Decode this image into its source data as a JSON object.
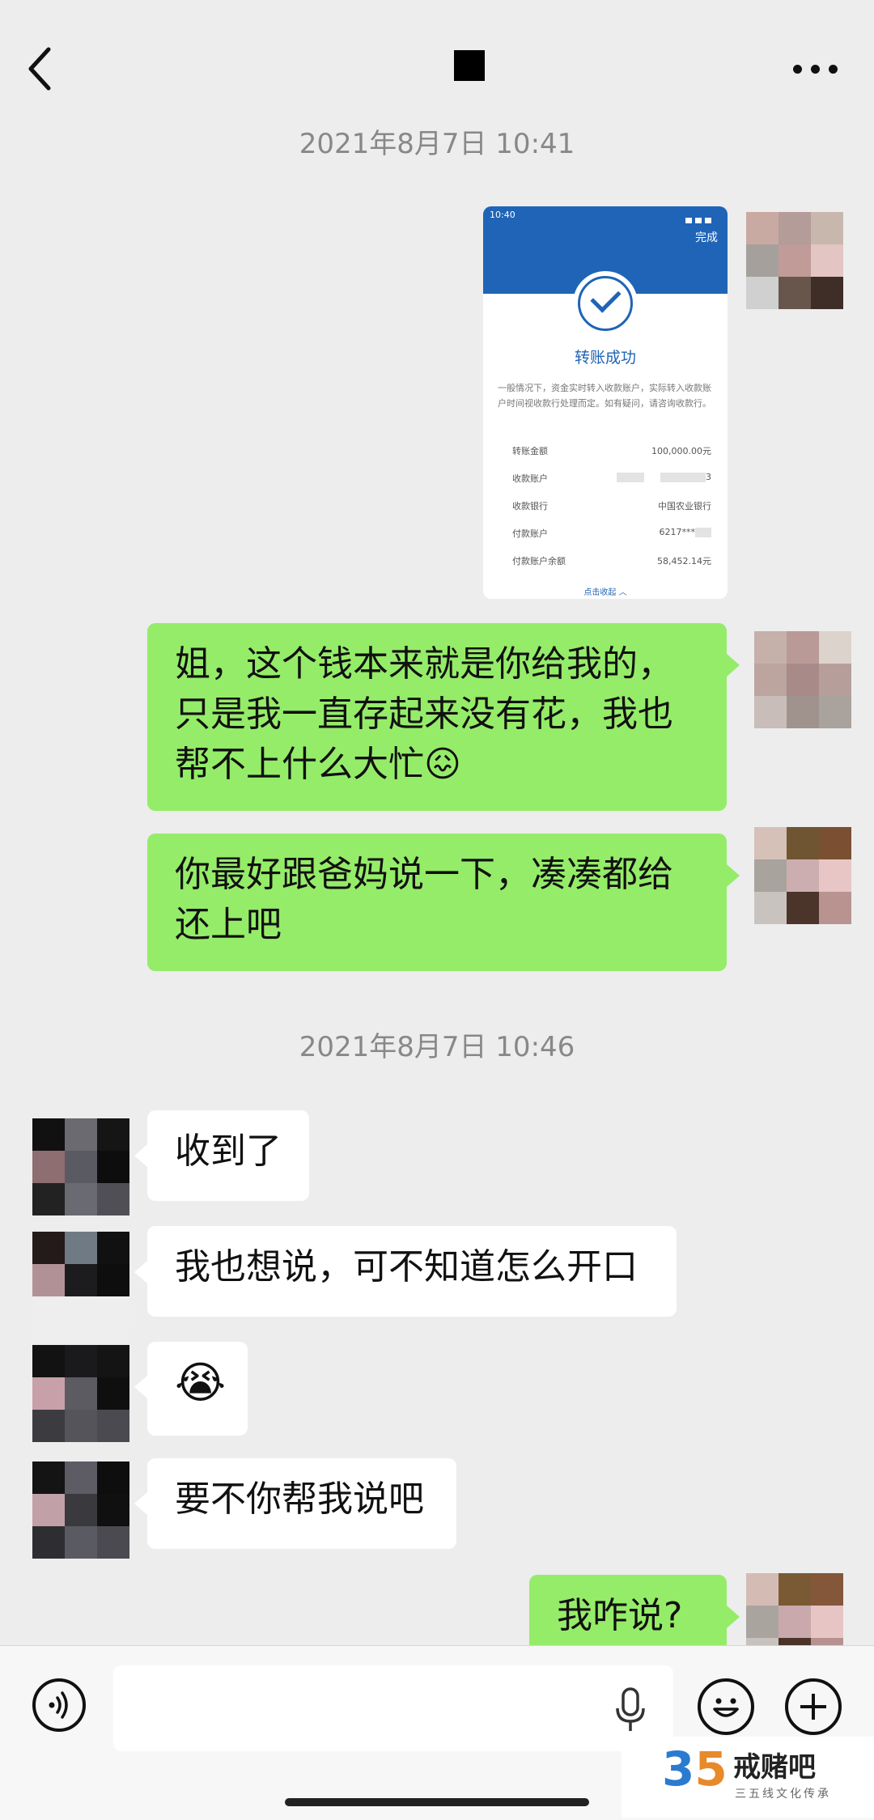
{
  "header": {
    "back_icon": "chevron-left-icon",
    "more_icon": "more-dots-icon"
  },
  "timestamps": [
    "2021年8月7日 10:41",
    "2021年8月7日 10:46"
  ],
  "transfer_screenshot": {
    "status_time": "10:40",
    "done_label": "完成",
    "status": "转账成功",
    "note": "一般情况下，资金实时转入收款账户，实际转入收款账户时间视收款行处理而定。如有疑问，请咨询收款行。",
    "rows": [
      {
        "label": "转账金额",
        "value": "100,000.00元"
      },
      {
        "label": "收款账户",
        "value": "3"
      },
      {
        "label": "收款银行",
        "value": "中国农业银行"
      },
      {
        "label": "付款账户",
        "value": "6217***"
      },
      {
        "label": "付款账户余额",
        "value": "58,452.14元"
      }
    ],
    "collapse_label": "点击收起 ︿"
  },
  "messages": [
    {
      "side": "right",
      "text": "姐，这个钱本来就是你给我的，只是我一直存起来没有花，我也帮不上什么大忙😖"
    },
    {
      "side": "right",
      "text": "你最好跟爸妈说一下，凑凑都给还上吧"
    },
    {
      "side": "left",
      "text": "收到了"
    },
    {
      "side": "left",
      "text": "我也想说，可不知道怎么开口"
    },
    {
      "side": "left",
      "text": "😭"
    },
    {
      "side": "left",
      "text": "要不你帮我说吧"
    },
    {
      "side": "right",
      "text": "我咋说?"
    }
  ],
  "input_bar": {
    "voice_icon": "voice-icon",
    "mic_icon": "microphone-icon",
    "emoji_icon": "smiley-icon",
    "plus_icon": "plus-icon"
  },
  "watermark": {
    "number_a": "3",
    "number_b": "5",
    "name": "戒赌吧",
    "subtitle": "三五线文化传承"
  }
}
